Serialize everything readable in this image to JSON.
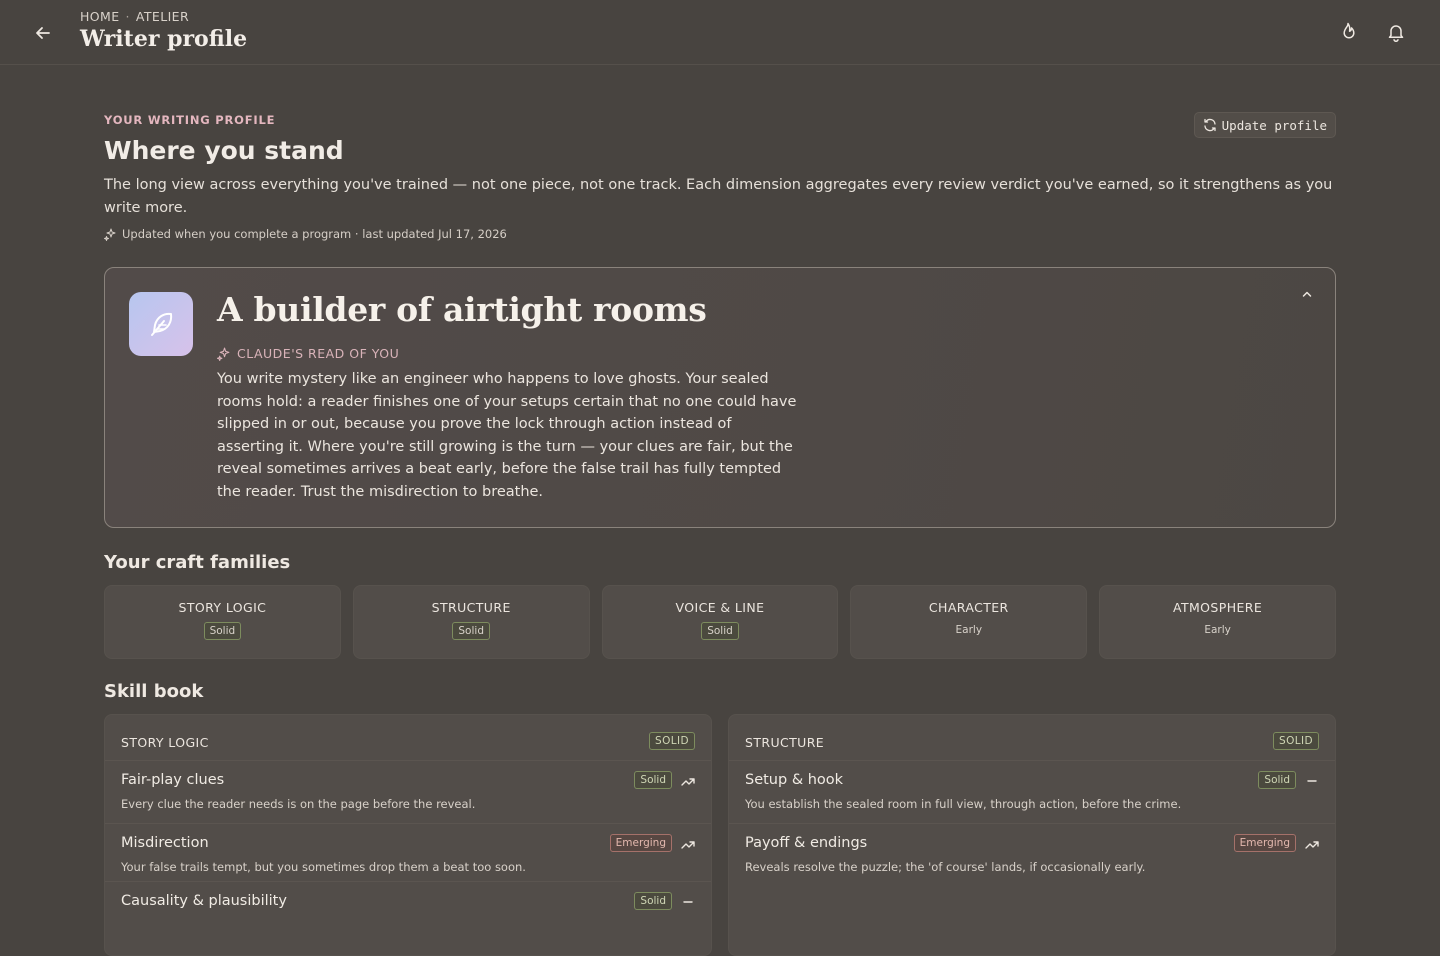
{
  "header": {
    "breadcrumb": [
      "HOME",
      "ATELIER"
    ],
    "breadcrumb_sep": "·",
    "title": "Writer profile"
  },
  "intro": {
    "eyebrow": "YOUR WRITING PROFILE",
    "title": "Where you stand",
    "lede": "The long view across everything you've trained — not one piece, not one track. Each dimension aggregates every review verdict you've earned, so it strengthens as you write more.",
    "updated": "Updated when you complete a program · last updated Jul 17, 2026",
    "update_button": "Update profile"
  },
  "hero": {
    "title": "A builder of airtight rooms",
    "eyebrow": "CLAUDE'S READ OF YOU",
    "text": "You write mystery like an engineer who happens to love ghosts. Your sealed rooms hold: a reader finishes one of your setups certain that no one could have slipped in or out, because you prove the lock through action instead of asserting it. Where you're still growing is the turn — your clues are fair, but the reveal sometimes arrives a beat early, before the false trail has fully tempted the reader. Trust the misdirection to breathe."
  },
  "families": {
    "title": "Your craft families",
    "items": [
      {
        "name": "STORY LOGIC",
        "level": "Solid"
      },
      {
        "name": "STRUCTURE",
        "level": "Solid"
      },
      {
        "name": "VOICE & LINE",
        "level": "Solid"
      },
      {
        "name": "CHARACTER",
        "level": "Early"
      },
      {
        "name": "ATMOSPHERE",
        "level": "Early"
      }
    ]
  },
  "skillbook": {
    "title": "Skill book",
    "cards": [
      {
        "name": "STORY LOGIC",
        "level": "SOLID",
        "skills": [
          {
            "name": "Fair-play clues",
            "desc": "Every clue the reader needs is on the page before the reveal.",
            "level": "Solid",
            "trend": "up"
          },
          {
            "name": "Misdirection",
            "desc": "Your false trails tempt, but you sometimes drop them a beat too soon.",
            "level": "Emerging",
            "trend": "up"
          },
          {
            "name": "Causality & plausibility",
            "desc": "",
            "level": "Solid",
            "trend": "flat"
          }
        ]
      },
      {
        "name": "STRUCTURE",
        "level": "SOLID",
        "skills": [
          {
            "name": "Setup & hook",
            "desc": "You establish the sealed room in full view, through action, before the crime.",
            "level": "Solid",
            "trend": "flat"
          },
          {
            "name": "Payoff & endings",
            "desc": "Reveals resolve the puzzle; the 'of course' lands, if occasionally early.",
            "level": "Emerging",
            "trend": "up"
          }
        ]
      }
    ]
  }
}
